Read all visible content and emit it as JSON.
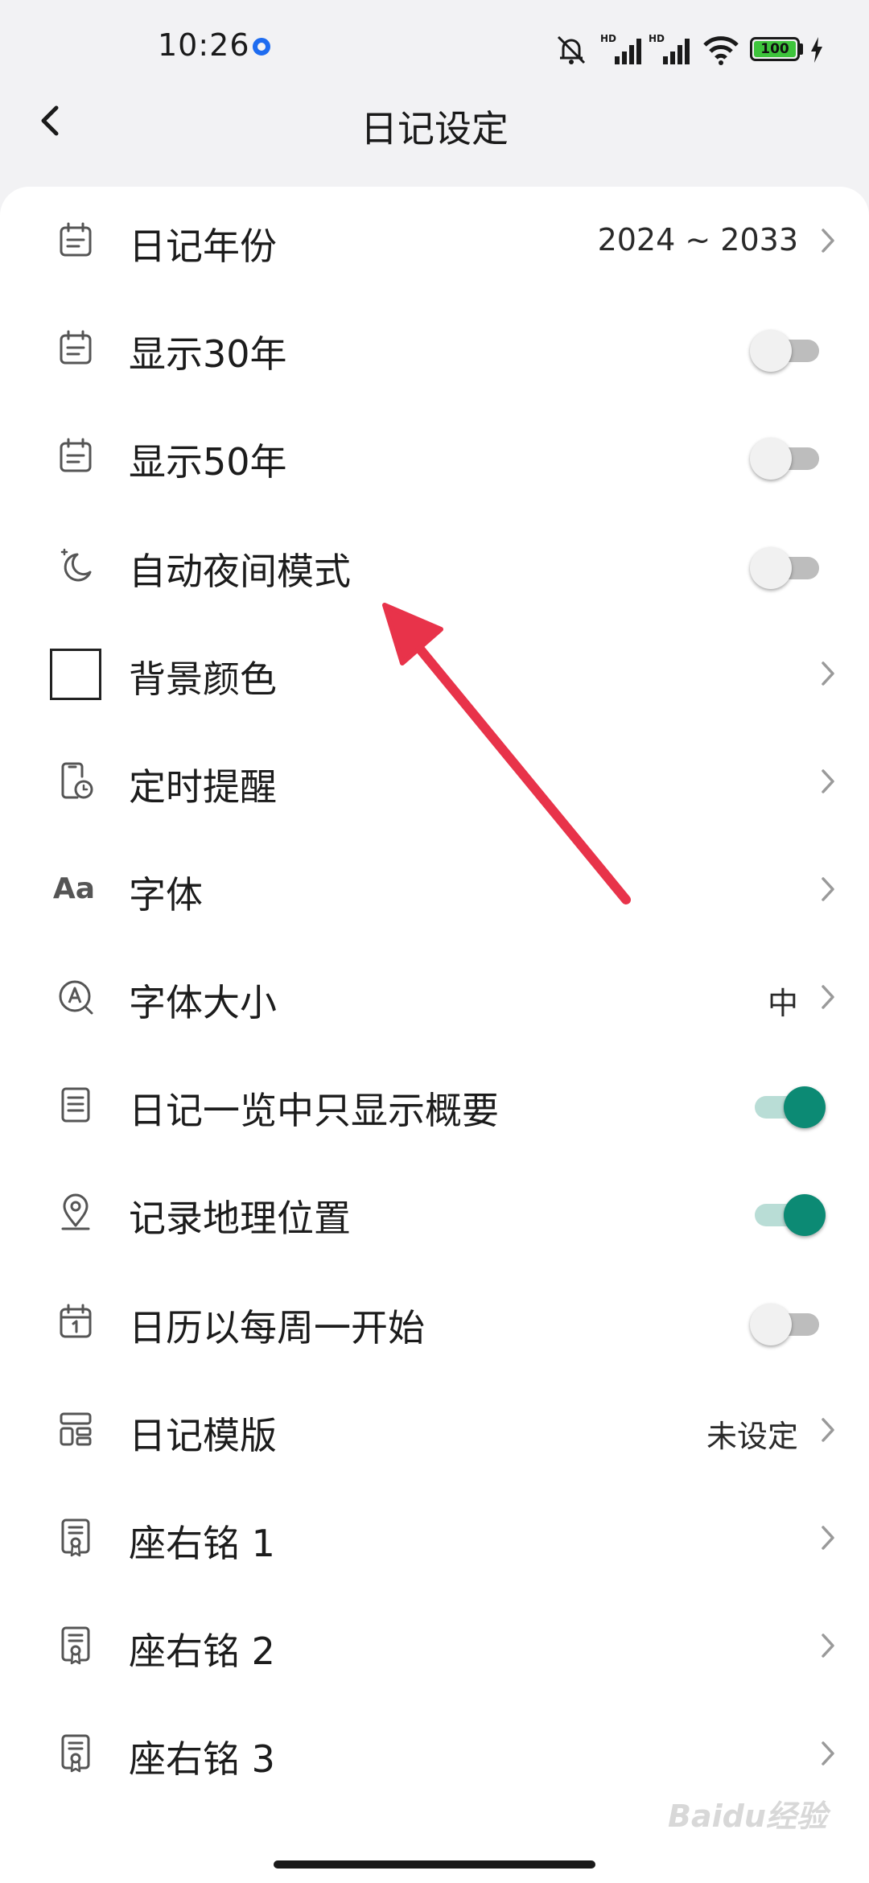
{
  "status_bar": {
    "time": "10:26",
    "battery_level": "100",
    "network_label_1": "HD",
    "network_label_2": "HD"
  },
  "header": {
    "title": "日记设定"
  },
  "settings": [
    {
      "label": "日记年份",
      "value": "2024 ~ 2033",
      "control": "chevron",
      "icon": "calendar-icon"
    },
    {
      "label": "显示30年",
      "control": "toggle",
      "state": "off",
      "icon": "calendar-icon"
    },
    {
      "label": "显示50年",
      "control": "toggle",
      "state": "off",
      "icon": "calendar-icon"
    },
    {
      "label": "自动夜间模式",
      "control": "toggle",
      "state": "off",
      "icon": "moon-icon"
    },
    {
      "label": "背景颜色",
      "control": "chevron",
      "icon": "color-swatch-icon",
      "swatch_color": "#ffffff"
    },
    {
      "label": "定时提醒",
      "control": "chevron",
      "icon": "phone-clock-icon"
    },
    {
      "label": "字体",
      "control": "chevron",
      "icon": "font-icon",
      "icon_text": "Aa"
    },
    {
      "label": "字体大小",
      "value": "中",
      "control": "chevron",
      "icon": "font-size-icon"
    },
    {
      "label": "日记一览中只显示概要",
      "control": "toggle",
      "state": "on",
      "icon": "document-lines-icon"
    },
    {
      "label": "记录地理位置",
      "control": "toggle",
      "state": "on",
      "icon": "location-pin-icon"
    },
    {
      "label": "日历以每周一开始",
      "control": "toggle",
      "state": "off",
      "icon": "calendar-one-icon"
    },
    {
      "label": "日记模版",
      "value": "未设定",
      "control": "chevron",
      "icon": "template-icon"
    },
    {
      "label": "座右铭 1",
      "control": "chevron",
      "icon": "certificate-icon"
    },
    {
      "label": "座右铭 2",
      "control": "chevron",
      "icon": "certificate-icon"
    },
    {
      "label": "座右铭 3",
      "control": "chevron",
      "icon": "certificate-icon"
    }
  ],
  "watermark": "Baidu经验",
  "colors": {
    "toggle_on": "#0c8a74",
    "toggle_on_track": "#b9ddd6",
    "toggle_off_track": "#bdbdbd",
    "arrow": "#e8334a",
    "location_dot": "#1e6cf0",
    "battery": "#3ec43c"
  }
}
